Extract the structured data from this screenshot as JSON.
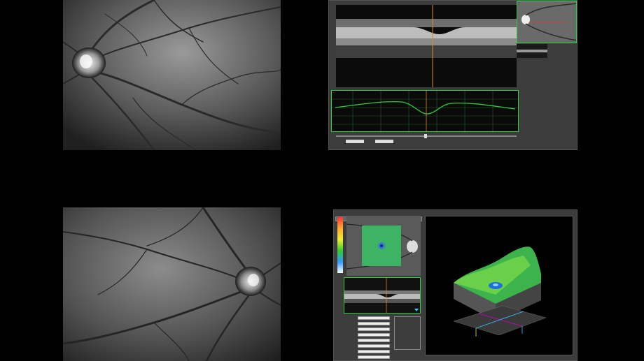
{
  "screens": {
    "top_right": {
      "oct_header_text": "",
      "thickness_label": "",
      "scan_label": "",
      "ctl_a": "",
      "ctl_b": ""
    },
    "bottom_right": {
      "tabs": [
        "",
        "",
        "",
        "",
        "",
        "",
        "",
        "",
        "",
        "",
        "",
        ""
      ],
      "bscan_label": "",
      "controls": [
        {
          "label": "",
          "value": ""
        },
        {
          "label": "",
          "value": ""
        },
        {
          "label": "",
          "value": ""
        },
        {
          "label": "",
          "value": ""
        },
        {
          "label": "",
          "value": ""
        },
        {
          "label": "",
          "value": ""
        },
        {
          "label": "",
          "value": ""
        },
        {
          "label": "",
          "value": ""
        }
      ],
      "layer_checks": [
        "",
        "",
        "",
        "",
        "",
        ""
      ]
    }
  },
  "colors": {
    "background": "#000000",
    "panel": "#3c3c3c",
    "thickness_line": "#2ecc40",
    "grid": "#1f5f2a",
    "crosshair": "#e08a1a",
    "map_green": "#46c850"
  }
}
